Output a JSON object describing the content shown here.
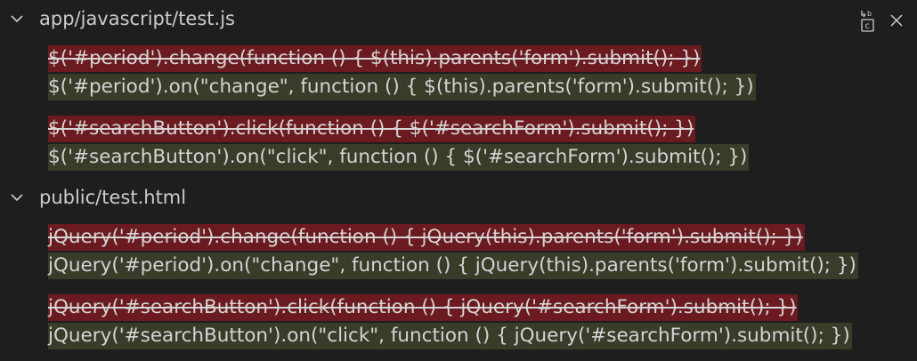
{
  "files": [
    {
      "name": "app/javascript/test.js",
      "changes": [
        {
          "removed": "$('#period').change(function () { $(this).parents('form').submit(); })",
          "added": "$('#period').on(\"change\", function () { $(this).parents('form').submit(); })"
        },
        {
          "removed": "$('#searchButton').click(function () { $('#searchForm').submit(); })",
          "added": "$('#searchButton').on(\"click\", function () { $('#searchForm').submit(); })"
        }
      ]
    },
    {
      "name": "public/test.html",
      "changes": [
        {
          "removed": "jQuery('#period').change(function () { jQuery(this).parents('form').submit(); })",
          "added": "jQuery('#period').on(\"change\", function () { jQuery(this).parents('form').submit(); })"
        },
        {
          "removed": "jQuery('#searchButton').click(function () { jQuery('#searchForm').submit(); })",
          "added": "jQuery('#searchButton').on(\"click\", function () { jQuery('#searchForm').submit(); })"
        }
      ]
    }
  ],
  "toolbar": {
    "replace_icon": "replace-all-icon",
    "close_icon": "close-icon"
  },
  "colors": {
    "background": "#1e1e1e",
    "removed_bg": "#6b1a1f",
    "added_bg": "#373d29",
    "text": "#d4d4d4"
  }
}
